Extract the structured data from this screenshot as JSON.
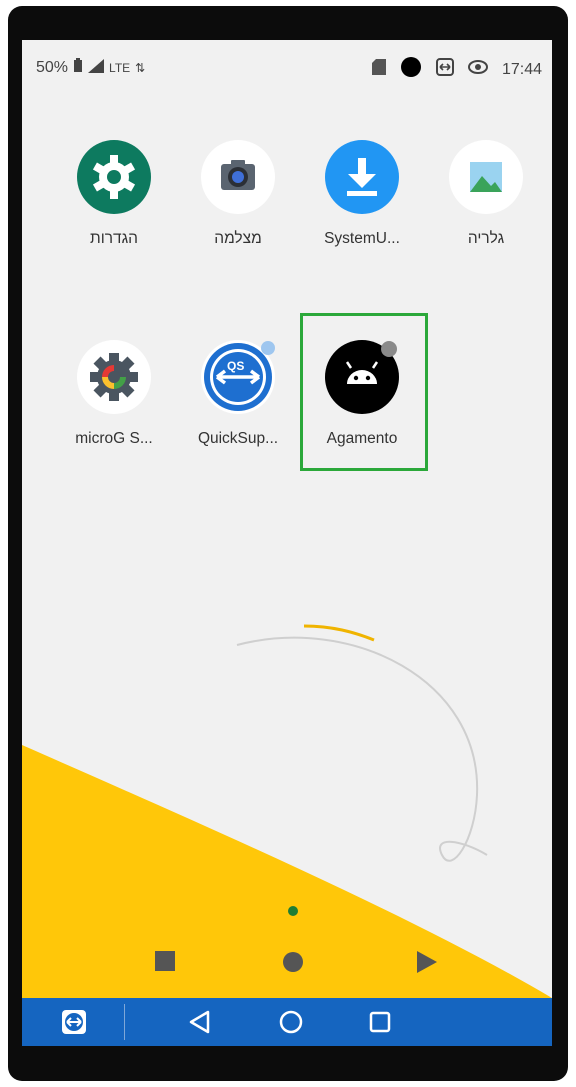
{
  "status_bar": {
    "battery_percent": "50%",
    "network": "LTE",
    "time": "17:44",
    "icons_left": [
      "battery-icon",
      "signal-icon",
      "data-arrows-icon"
    ],
    "icons_right": [
      "sd-card-icon",
      "circle-notification-icon",
      "teamviewer-icon",
      "eye-icon"
    ]
  },
  "apps": [
    {
      "label": "הגדרות",
      "icon": "settings-gear-icon",
      "color": "#0d7a5f"
    },
    {
      "label": "מצלמה",
      "icon": "camera-icon",
      "color": "#ffffff"
    },
    {
      "label": "SystemU...",
      "icon": "download-icon",
      "color": "#2196f3"
    },
    {
      "label": "גלריה",
      "icon": "gallery-icon",
      "color": "#ffffff"
    },
    {
      "label": "microG S...",
      "icon": "microg-icon",
      "color": "#ffffff"
    },
    {
      "label": "QuickSup...",
      "icon": "quicksupport-icon",
      "color": "#ffffff"
    },
    {
      "label": "Agamento",
      "icon": "android-icon",
      "color": "#000000"
    }
  ],
  "highlight_color": "#2ba83a",
  "wallpaper": {
    "primary": "#f1f1f1",
    "accent": "#ffc709"
  },
  "navbar": {
    "background": "#1565c0",
    "items": [
      "teamviewer-button",
      "back-button",
      "home-button",
      "recents-button"
    ]
  }
}
